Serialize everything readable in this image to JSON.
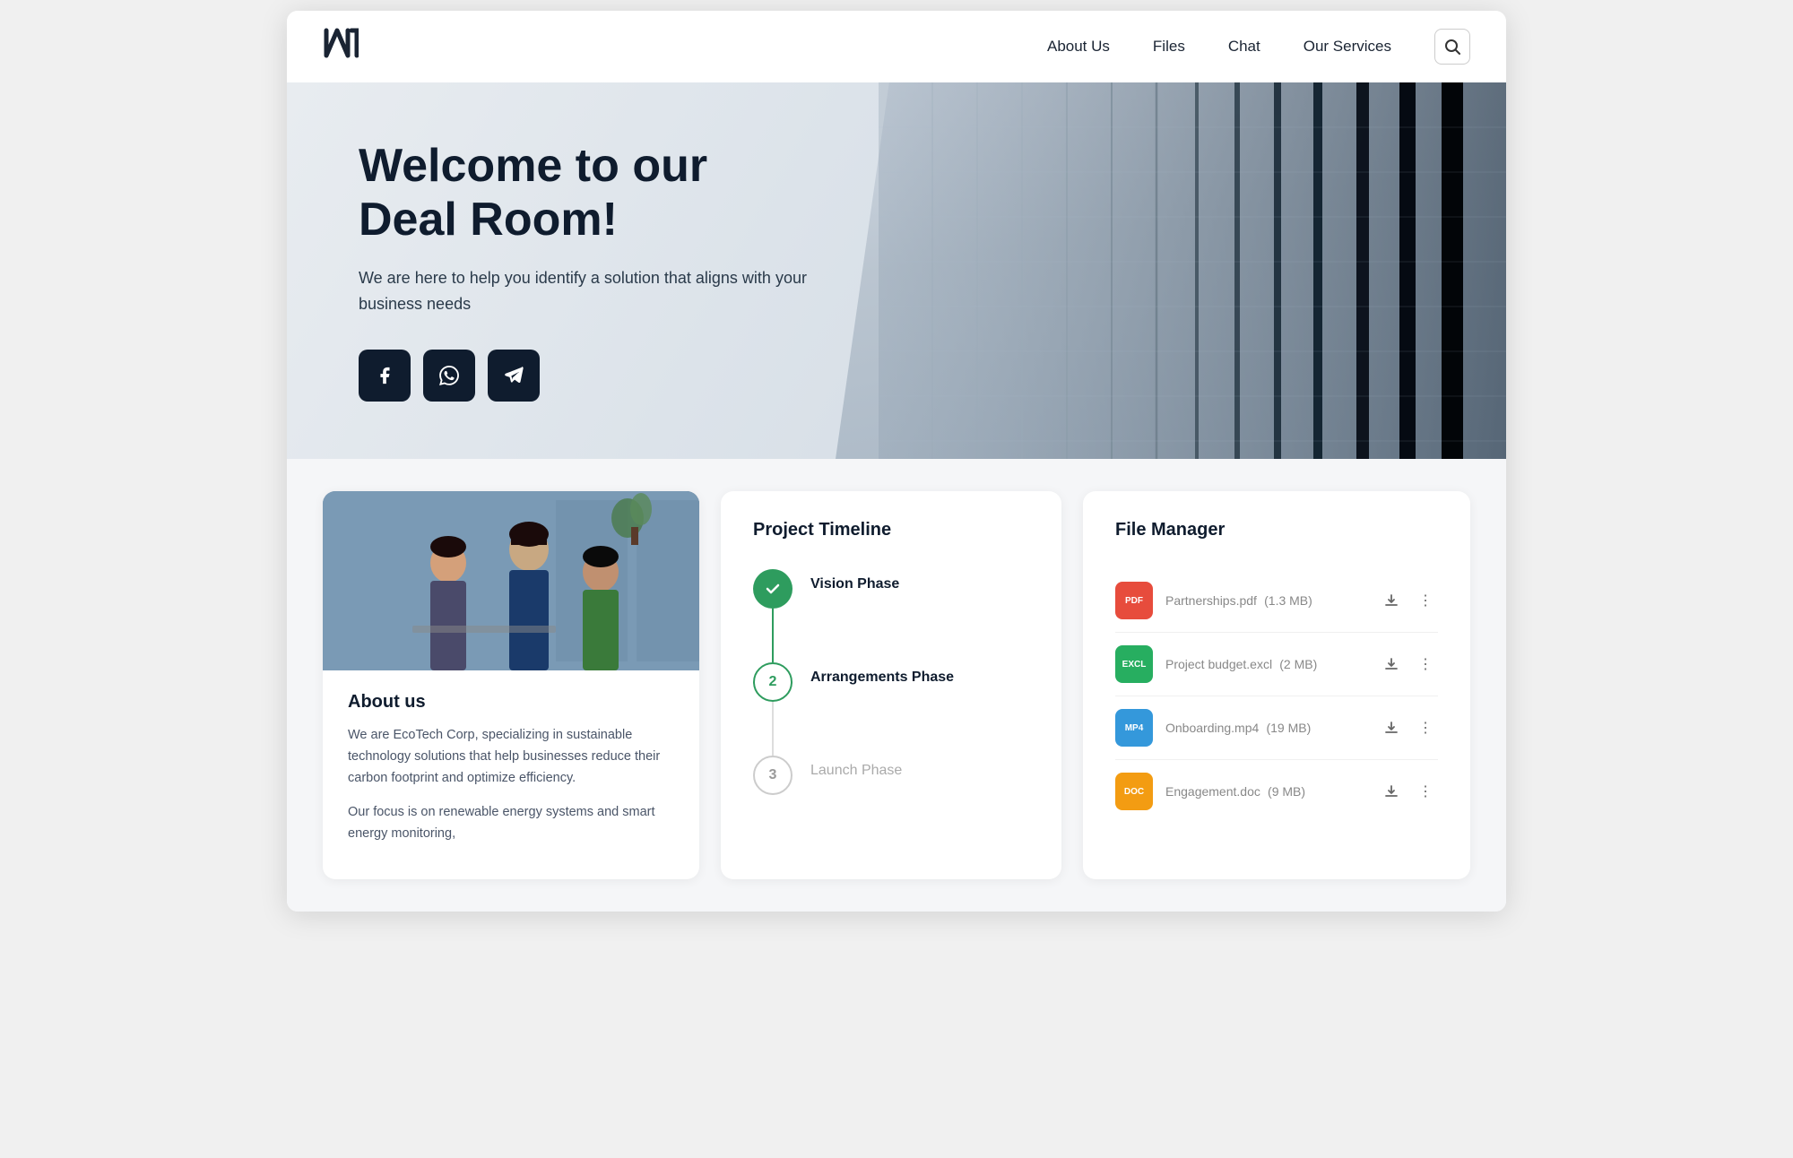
{
  "logo": {
    "text": "N"
  },
  "nav": {
    "links": [
      {
        "label": "About Us",
        "id": "about-us"
      },
      {
        "label": "Files",
        "id": "files"
      },
      {
        "label": "Chat",
        "id": "chat"
      },
      {
        "label": "Our Services",
        "id": "our-services"
      }
    ],
    "search_icon": "🔍"
  },
  "hero": {
    "title": "Welcome to our Deal Room!",
    "subtitle": "We are here to help you identify a solution that aligns with your business needs",
    "social_buttons": [
      {
        "label": "f",
        "name": "facebook",
        "icon": "f"
      },
      {
        "label": "📞",
        "name": "whatsapp",
        "icon": "📞"
      },
      {
        "label": "✈",
        "name": "telegram",
        "icon": "✈"
      }
    ]
  },
  "about": {
    "heading": "About us",
    "body1": "We are EcoTech Corp, specializing in sustainable technology solutions that help businesses reduce their carbon footprint and optimize efficiency.",
    "body2": "Our focus is on renewable energy systems and smart energy monitoring,"
  },
  "timeline": {
    "title": "Project Timeline",
    "steps": [
      {
        "number": "✓",
        "label": "Vision Phase",
        "state": "active"
      },
      {
        "number": "2",
        "label": "Arrangements Phase",
        "state": "current"
      },
      {
        "number": "3",
        "label": "Launch Phase",
        "state": "inactive"
      }
    ]
  },
  "filemanager": {
    "title": "File Manager",
    "files": [
      {
        "badge": "PDF",
        "badge_class": "badge-pdf",
        "name": "Partnerships.pdf",
        "size": "(1.3 MB)"
      },
      {
        "badge": "EXCL",
        "badge_class": "badge-excl",
        "name": "Project budget.excl",
        "size": "(2 MB)"
      },
      {
        "badge": "MP4",
        "badge_class": "badge-mp4",
        "name": "Onboarding.mp4",
        "size": "(19 MB)"
      },
      {
        "badge": "DOC",
        "badge_class": "badge-doc",
        "name": "Engagement.doc",
        "size": "(9 MB)"
      }
    ]
  }
}
